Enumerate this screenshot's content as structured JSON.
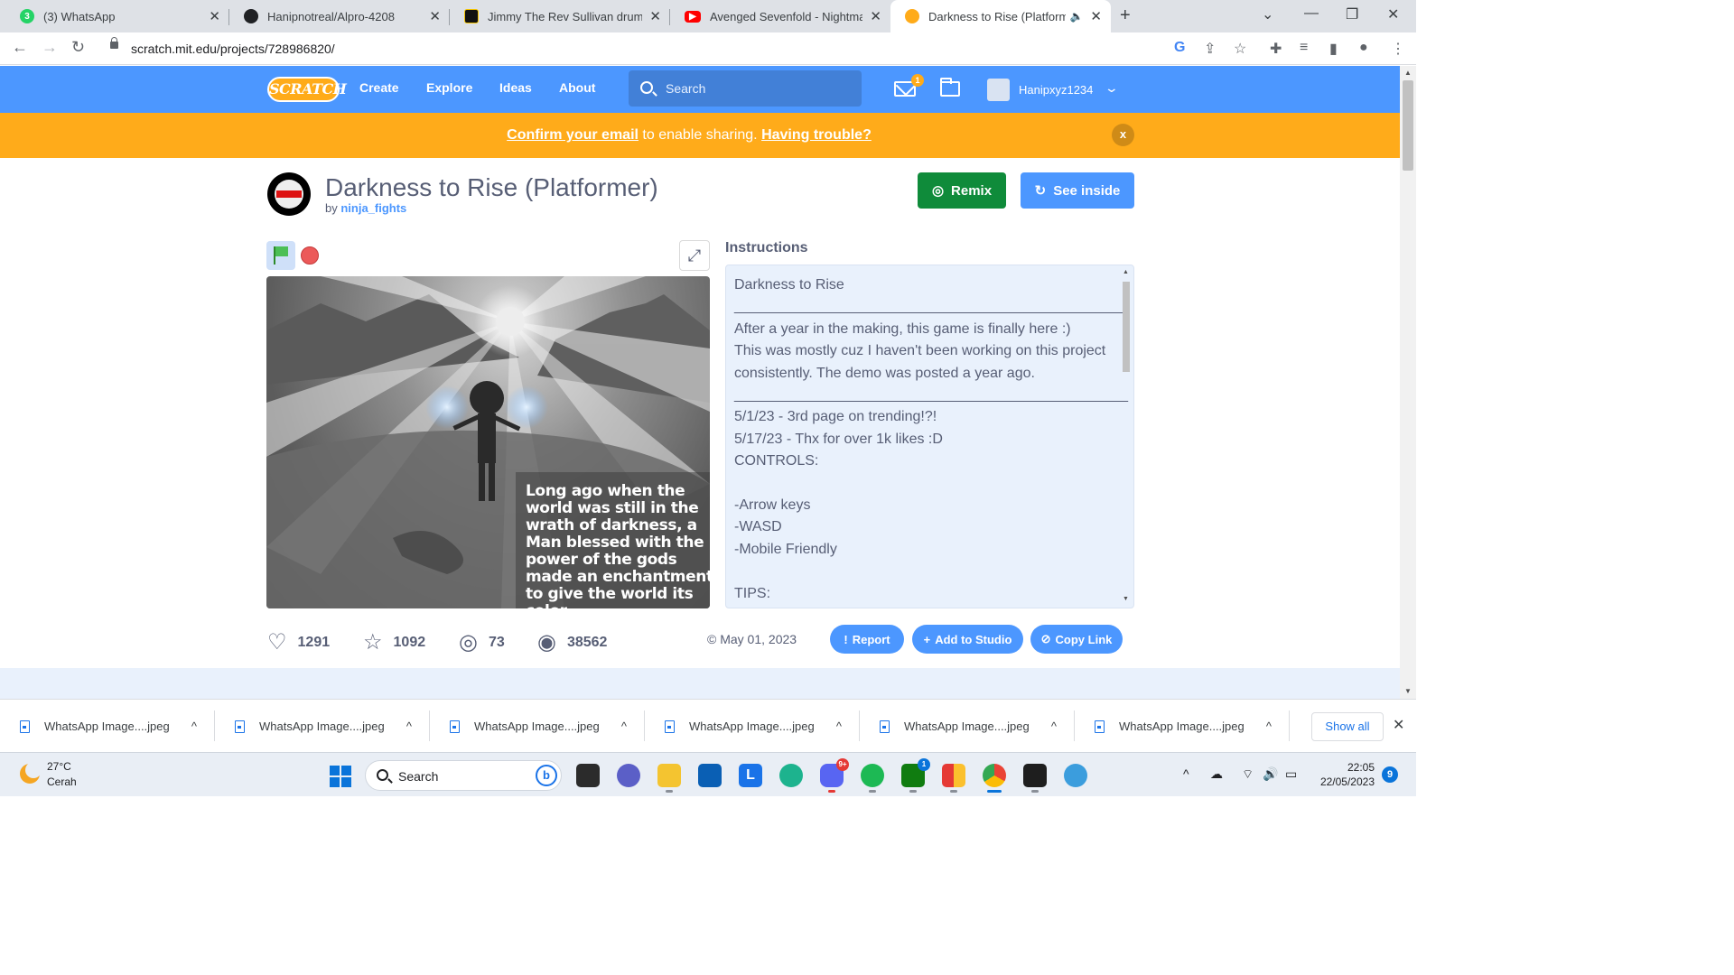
{
  "browser": {
    "tabs": [
      {
        "title": "(3) WhatsApp",
        "favicon": "whatsapp-icon",
        "badge": "3"
      },
      {
        "title": "Hanipnotreal/Alpro-4208",
        "favicon": "github-icon"
      },
      {
        "title": "Jimmy The Rev Sullivan drums | A",
        "favicon": "video-icon"
      },
      {
        "title": "Avenged Sevenfold - Nightmare",
        "favicon": "youtube-icon"
      },
      {
        "title": "Darkness to Rise (Platformer",
        "favicon": "scratch-icon",
        "active": true
      }
    ],
    "url": "scratch.mit.edu/projects/728986820/"
  },
  "scratch_nav": {
    "logo": "SCRATCH",
    "links": [
      "Create",
      "Explore",
      "Ideas",
      "About"
    ],
    "search_placeholder": "Search",
    "message_count": "1",
    "username": "Hanipxyz1234"
  },
  "banner": {
    "link1": "Confirm your email",
    "middle": " to enable sharing. ",
    "link2": "Having trouble?",
    "close": "x"
  },
  "project": {
    "title": "Darkness to Rise (Platformer)",
    "by_prefix": "by ",
    "author": "ninja_fights",
    "remix_label": "Remix",
    "see_inside_label": "See inside",
    "stage_caption": "Long ago when the world was still in the wrath of darkness, a Man blessed with the power of the gods made an enchantment to give the world its color.",
    "instructions_heading": "Instructions",
    "instructions_text": "Darkness to Rise\n_________________________________________________\nAfter a year in the making, this game is finally here :)\nThis was mostly cuz I haven't been working on this project consistently. The demo was posted a year ago.\n_________________________________________________\n5/1/23 - 3rd page on trending!?!\n5/17/23 - Thx for over 1k likes :D\nCONTROLS:\n\n-Arrow keys\n-WASD\n-Mobile Friendly\n\nTIPS:",
    "stats": {
      "loves": "1291",
      "favorites": "1092",
      "remixes": "73",
      "views": "38562"
    },
    "date": "May 01, 2023",
    "report_label": "Report",
    "add_to_studio_label": "Add to Studio",
    "copy_link_label": "Copy Link"
  },
  "downloads": {
    "items": [
      "WhatsApp Image....jpeg",
      "WhatsApp Image....jpeg",
      "WhatsApp Image....jpeg",
      "WhatsApp Image....jpeg",
      "WhatsApp Image....jpeg",
      "WhatsApp Image....jpeg"
    ],
    "show_all": "Show all"
  },
  "taskbar": {
    "weather_temp": "27°C",
    "weather_desc": "Cerah",
    "search_label": "Search",
    "discord_badge": "9+",
    "xbox_badge": "1",
    "time": "22:05",
    "date": "22/05/2023",
    "notifications": "9"
  },
  "colors": {
    "scratch_blue": "#4c97ff",
    "banner_orange": "#ffab1a",
    "remix_green": "#0f8b3a"
  }
}
